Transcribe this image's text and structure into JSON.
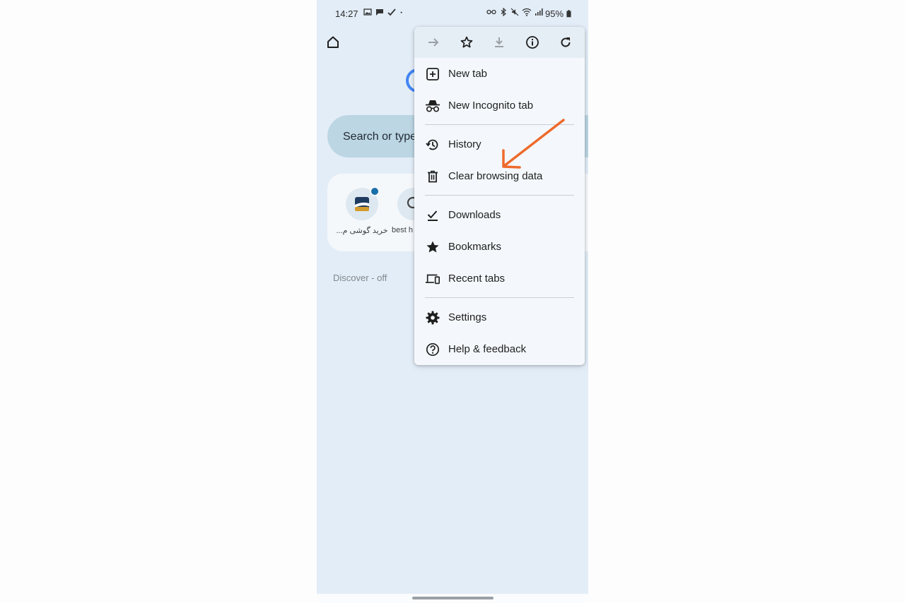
{
  "status_bar": {
    "time": "14:27",
    "battery": "95%",
    "left_icons": [
      "gallery-icon",
      "message-icon",
      "check-icon",
      "dot-icon"
    ],
    "right_icons": [
      "vr-icon",
      "bluetooth-icon",
      "mute-icon",
      "wifi-icon",
      "signal-icon",
      "battery-icon"
    ]
  },
  "new_tab_page": {
    "search_placeholder": "Search or type",
    "shortcuts": [
      {
        "label": "خرید گوشی م...",
        "icon": "site-favicon"
      },
      {
        "label": "best h",
        "icon": "search-icon"
      }
    ],
    "discover_label": "Discover - off"
  },
  "menu": {
    "toolbar": [
      "forward-icon",
      "bookmark-star-icon",
      "download-icon",
      "info-icon",
      "refresh-icon"
    ],
    "items": [
      {
        "label": "New tab",
        "icon": "new-tab-icon"
      },
      {
        "label": "New Incognito tab",
        "icon": "incognito-icon"
      },
      {
        "label": "History",
        "icon": "history-icon"
      },
      {
        "label": "Clear browsing data",
        "icon": "trash-icon"
      },
      {
        "label": "Downloads",
        "icon": "downloads-icon"
      },
      {
        "label": "Bookmarks",
        "icon": "bookmarks-icon"
      },
      {
        "label": "Recent tabs",
        "icon": "recent-tabs-icon"
      },
      {
        "label": "Settings",
        "icon": "settings-icon"
      },
      {
        "label": "Help & feedback",
        "icon": "help-icon"
      }
    ]
  },
  "colors": {
    "annotation_arrow": "#ee6a2c",
    "page_background": "#e3edf7",
    "menu_background": "#f4f8fc",
    "search_box": "#bcd6e3"
  }
}
